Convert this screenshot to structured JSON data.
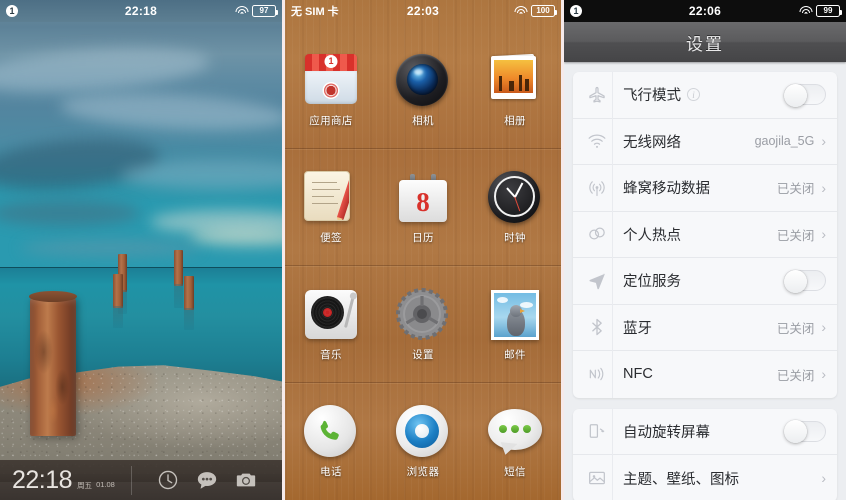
{
  "lockscreen": {
    "status": {
      "badge": "1",
      "time": "22:18",
      "battery": "97",
      "wifi_icon": "wifi-icon",
      "battery_icon": "battery-icon"
    },
    "clock": "22:18",
    "weekday": "周五",
    "date": "01.08",
    "shortcuts": [
      {
        "name": "clock-icon",
        "label": "clock"
      },
      {
        "name": "messages-icon",
        "label": "messages"
      },
      {
        "name": "camera-icon",
        "label": "camera"
      }
    ]
  },
  "homescreen": {
    "status": {
      "carrier": "无 SIM 卡",
      "time": "22:03",
      "battery": "100"
    },
    "apps": [
      {
        "label": "应用商店",
        "icon": "app-store-icon",
        "badge": "1"
      },
      {
        "label": "相机",
        "icon": "camera-icon"
      },
      {
        "label": "相册",
        "icon": "photos-icon"
      },
      {
        "label": "便签",
        "icon": "notes-icon"
      },
      {
        "label": "日历",
        "icon": "calendar-icon",
        "day": "8"
      },
      {
        "label": "时钟",
        "icon": "clock-icon"
      },
      {
        "label": "音乐",
        "icon": "music-icon"
      },
      {
        "label": "设置",
        "icon": "settings-gear-icon"
      },
      {
        "label": "邮件",
        "icon": "mail-icon"
      },
      {
        "label": "电话",
        "icon": "phone-icon"
      },
      {
        "label": "浏览器",
        "icon": "browser-icon"
      },
      {
        "label": "短信",
        "icon": "sms-icon"
      }
    ]
  },
  "settings": {
    "status": {
      "badge": "1",
      "time": "22:06",
      "battery": "99"
    },
    "title": "设置",
    "groups": [
      {
        "rows": [
          {
            "label": "飞行模式",
            "icon": "airplane-icon",
            "control": "toggle",
            "toggle_on": false,
            "info": true
          },
          {
            "label": "无线网络",
            "icon": "wifi-icon",
            "control": "value",
            "value": "gaojila_5G"
          },
          {
            "label": "蜂窝移动数据",
            "icon": "cellular-icon",
            "control": "value",
            "value": "已关闭"
          },
          {
            "label": "个人热点",
            "icon": "hotspot-icon",
            "control": "value",
            "value": "已关闭"
          },
          {
            "label": "定位服务",
            "icon": "location-icon",
            "control": "toggle",
            "toggle_on": false
          },
          {
            "label": "蓝牙",
            "icon": "bluetooth-icon",
            "control": "value",
            "value": "已关闭"
          },
          {
            "label": "NFC",
            "icon": "nfc-icon",
            "control": "value",
            "value": "已关闭"
          }
        ]
      },
      {
        "rows": [
          {
            "label": "自动旋转屏幕",
            "icon": "rotate-screen-icon",
            "control": "toggle",
            "toggle_on": false
          },
          {
            "label": "主题、壁纸、图标",
            "icon": "wallpaper-icon",
            "control": "chevron"
          }
        ]
      }
    ],
    "chevron_glyph": "›",
    "colors": {
      "header": "#5b5b5d",
      "page_bg": "#eceef1",
      "card": "#f7f8fa",
      "label": "#2a2c30",
      "value": "#9a9da4"
    }
  }
}
